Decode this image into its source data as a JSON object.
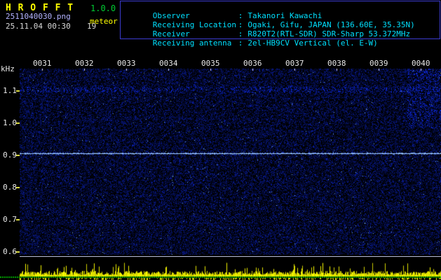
{
  "header": {
    "app_title": "H R O F F T",
    "version": "1.0.0",
    "filename": "2511040030.png",
    "mode": "meteor",
    "datetime": "25.11.04 00:30",
    "count": "19",
    "separator": ":",
    "info_rows": [
      {
        "label": "Observer",
        "value": "Takanori Kawachi"
      },
      {
        "label": "Receiving Location",
        "value": "Ogaki, Gifu, JAPAN (136.60E, 35.35N)"
      },
      {
        "label": "Receiver",
        "value": "R820T2(RTL-SDR) SDR-Sharp 53.372MHz"
      },
      {
        "label": "Receiving antenna",
        "value": "2el-HB9CV Vertical (el. E-W)"
      }
    ]
  },
  "axes": {
    "y_unit": "kHz",
    "y_ticks": [
      "1.1",
      "1.0",
      "0.9",
      "0.8",
      "0.7",
      "0.6"
    ],
    "x_ticks": [
      "0031",
      "0032",
      "0033",
      "0034",
      "0035",
      "0036",
      "0037",
      "0038",
      "0039",
      "0040"
    ]
  },
  "colors": {
    "background": "#000000",
    "title_yellow": "#ffff00",
    "version_green": "#00cc33",
    "info_cyan": "#00e0ff",
    "filename_blue": "#b3b3ff",
    "axis_label_white": "#e8e8e8",
    "tick_yellow": "#d8d840",
    "frame_blue": "#3b3bd0",
    "noise_blue": "#0000cc",
    "carrier_line": "#bfe0ff",
    "level_strip_yellow": "#ffff00",
    "baseline_green": "#00aa00"
  },
  "chart_data": {
    "type": "heatmap",
    "title": "HROFFT radio meteor spectrogram",
    "x_ticks": [
      "0031",
      "0032",
      "0033",
      "0034",
      "0035",
      "0036",
      "0037",
      "0038",
      "0039",
      "0040"
    ],
    "x_range": [
      "0030",
      "0040"
    ],
    "ylabel": "kHz",
    "y_ticks": [
      1.1,
      1.0,
      0.9,
      0.8,
      0.7,
      0.6
    ],
    "ylim": [
      0.56,
      1.16
    ],
    "legend": false,
    "grid": false,
    "features": [
      {
        "name": "carrier-line",
        "kind": "horizontal-line",
        "frequency_khz": 0.91,
        "span": "full-width",
        "color": "#bfe0ff"
      },
      {
        "name": "background-noise",
        "kind": "speckle",
        "color": "#0000cc"
      },
      {
        "name": "signal-level-strip",
        "kind": "bar-noise",
        "position": "bottom",
        "color": "#ffff00",
        "baseline_color": "#00aa00"
      }
    ]
  }
}
